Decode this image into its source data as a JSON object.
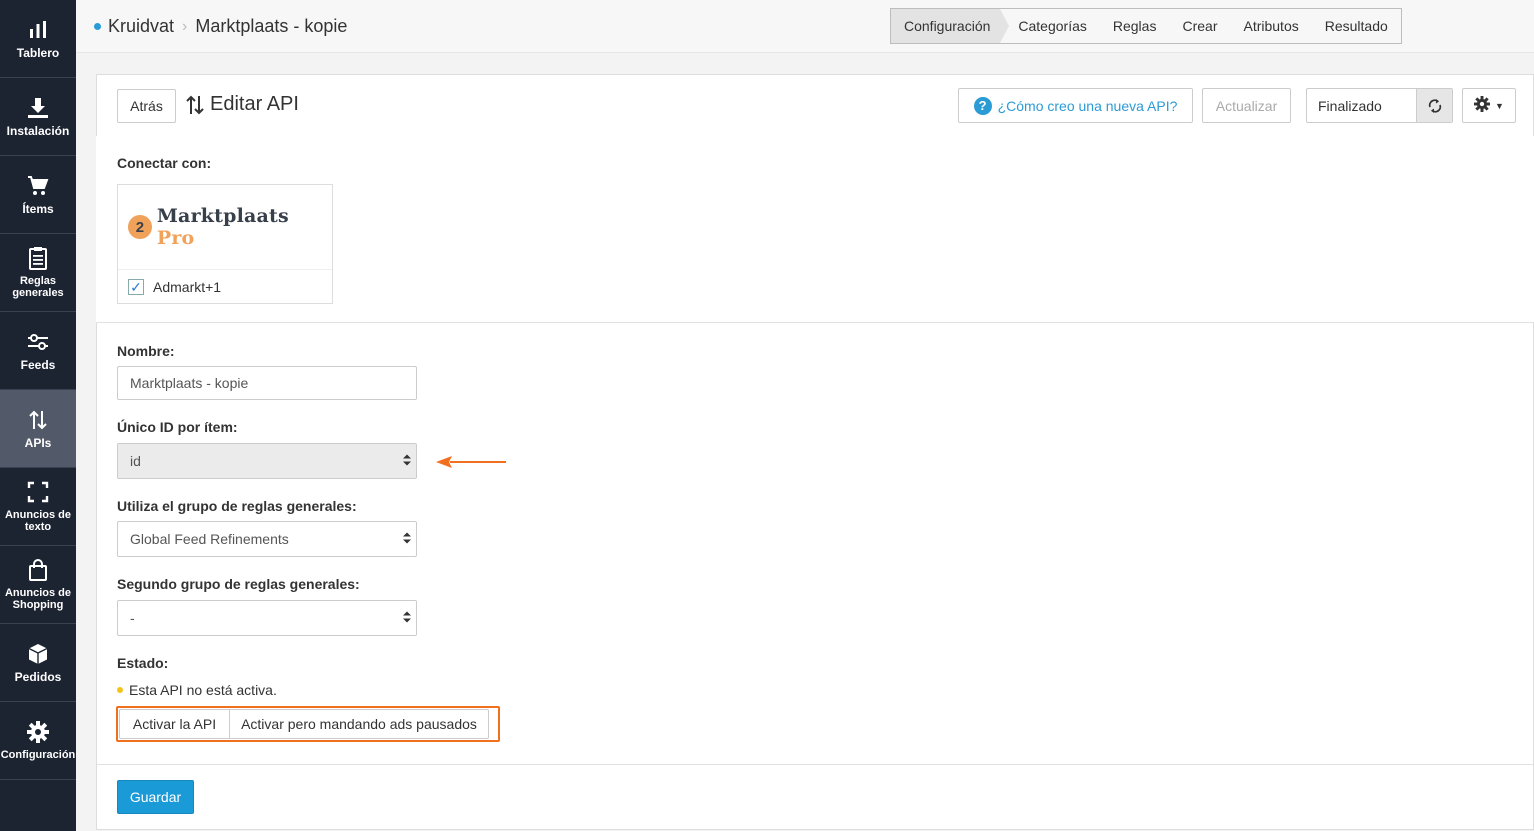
{
  "sidebar": {
    "items": [
      {
        "label": "Tablero",
        "icon": "bar-chart-icon"
      },
      {
        "label": "Instalación",
        "icon": "download-icon"
      },
      {
        "label": "Ítems",
        "icon": "cart-icon"
      },
      {
        "label": "Reglas generales",
        "icon": "clipboard-icon"
      },
      {
        "label": "Feeds",
        "icon": "sliders-icon"
      },
      {
        "label": "APIs",
        "icon": "up-down-arrows-icon"
      },
      {
        "label": "Anuncios de texto",
        "icon": "expand-icon"
      },
      {
        "label": "Anuncios de Shopping",
        "icon": "shopping-bag-icon"
      },
      {
        "label": "Pedidos",
        "icon": "box-icon"
      },
      {
        "label": "Configuración",
        "icon": "gear-icon"
      }
    ],
    "active_index": 5
  },
  "topbar": {
    "breadcrumb_root": "Kruidvat",
    "breadcrumb_current": "Marktplaats - kopie",
    "steps": [
      "Configuración",
      "Categorías",
      "Reglas",
      "Crear",
      "Atributos",
      "Resultado"
    ]
  },
  "header": {
    "back_label": "Atrás",
    "title": "Editar API",
    "help_label": "¿Cómo creo una nueva API?",
    "update_label": "Actualizar",
    "status_value": "Finalizado"
  },
  "connect": {
    "label": "Conectar con:",
    "logo_word": "Marktplaats",
    "logo_pro": "Pro",
    "logo_mark": "2",
    "account_label": "Admarkt+1",
    "account_checked": true
  },
  "form": {
    "name_label": "Nombre:",
    "name_value": "Marktplaats - kopie",
    "unique_id_label": "Único ID por ítem:",
    "unique_id_value": "id",
    "rules_group_label": "Utiliza el grupo de reglas generales:",
    "rules_group_value": "Global Feed Refinements",
    "second_rules_label": "Segundo grupo de reglas generales:",
    "second_rules_value": "-",
    "state_label": "Estado:",
    "state_text": "Esta API no está activa.",
    "activate_label": "Activar la API",
    "activate_paused_label": "Activar pero mandando ads pausados",
    "save_label": "Guardar"
  },
  "colors": {
    "sidebar_bg": "#1c2331",
    "sidebar_active": "#525a69",
    "accent": "#1a9ad6",
    "highlight": "#f07020",
    "status_dot": "#f3c21b"
  }
}
